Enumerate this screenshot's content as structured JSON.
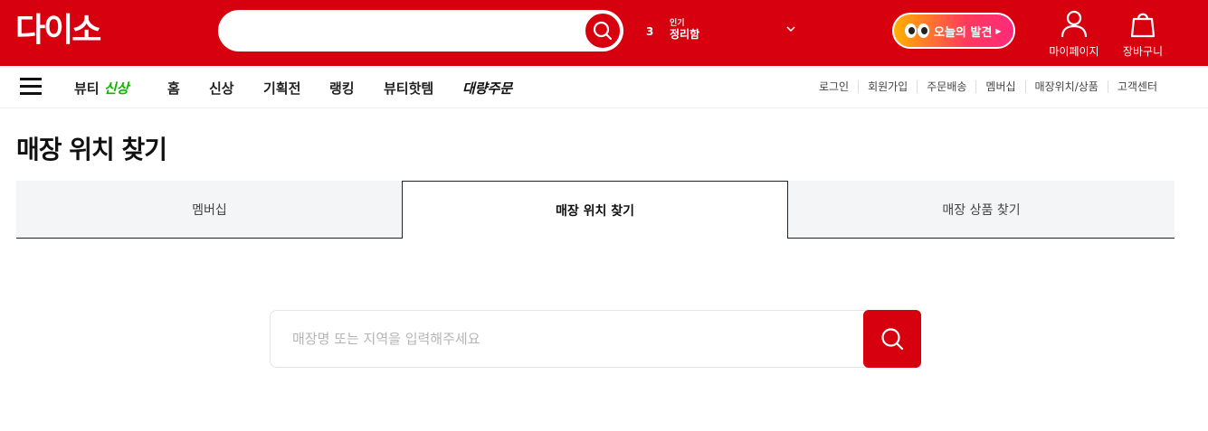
{
  "header": {
    "logo_text": "다이소",
    "search": {
      "value": "",
      "placeholder": ""
    },
    "ranking": {
      "number": "3",
      "prev_keyword": "인기",
      "keyword": "정리함"
    },
    "discover_label": "오늘의 발견",
    "my_page_label": "마이페이지",
    "cart_label": "장바구니",
    "brand_color": "#d6000f"
  },
  "nav": {
    "menu_icon": "hamburger-icon",
    "beauty_prefix": "뷰티",
    "beauty_suffix": "신상",
    "items": [
      "홈",
      "신상",
      "기획전",
      "랭킹",
      "뷰티핫템"
    ],
    "bulk_order": "대량주문",
    "util_links": [
      "로그인",
      "회원가입",
      "주문배송",
      "멤버십",
      "매장위치/상품",
      "고객센터"
    ]
  },
  "page": {
    "title": "매장 위치 찾기",
    "tabs": [
      {
        "label": "멤버십",
        "active": false
      },
      {
        "label": "매장 위치 찾기",
        "active": true
      },
      {
        "label": "매장 상품 찾기",
        "active": false
      }
    ],
    "store_search": {
      "value": "",
      "placeholder": "매장명 또는 지역을 입력해주세요"
    }
  }
}
